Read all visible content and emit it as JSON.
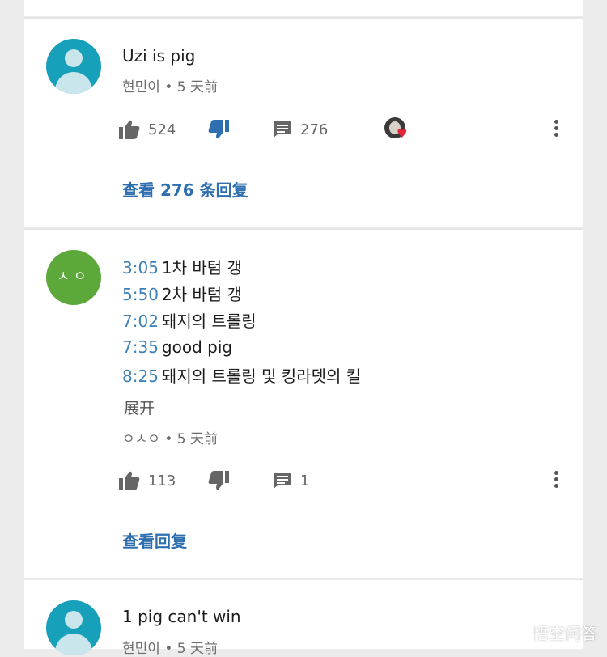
{
  "comments": [
    {
      "text": "Uzi is pig",
      "author": "현민이",
      "time": "• 5 天前",
      "likes": "524",
      "replies_count": "276",
      "view_replies": "查看 276 条回复"
    },
    {
      "avatar_text": "ㅅㅇ",
      "lines": [
        {
          "time": "3:05",
          "text": "1차 바텀 갱"
        },
        {
          "time": "5:50",
          "text": "2차 바텀 갱"
        },
        {
          "time": "7:02",
          "text": "돼지의 트롤링"
        },
        {
          "time": "7:35",
          "text": "good pig"
        },
        {
          "time": "8:25",
          "text": "돼지의 트롤링 및 킹라뎃의 킬"
        }
      ],
      "expand": "展开",
      "author": "ㅇㅅㅇ",
      "time": "• 5 天前",
      "likes": "113",
      "replies_count": "1",
      "view_replies": "查看回复"
    },
    {
      "text": "1 pig can't win",
      "author": "현민이",
      "time": "• 5 天前"
    }
  ],
  "watermark": "悟空问答",
  "colors": {
    "link": "#2f6fb0",
    "timestamp": "#3d7fb8",
    "liked": "#2f6fb0",
    "heart": "#e0283a"
  }
}
